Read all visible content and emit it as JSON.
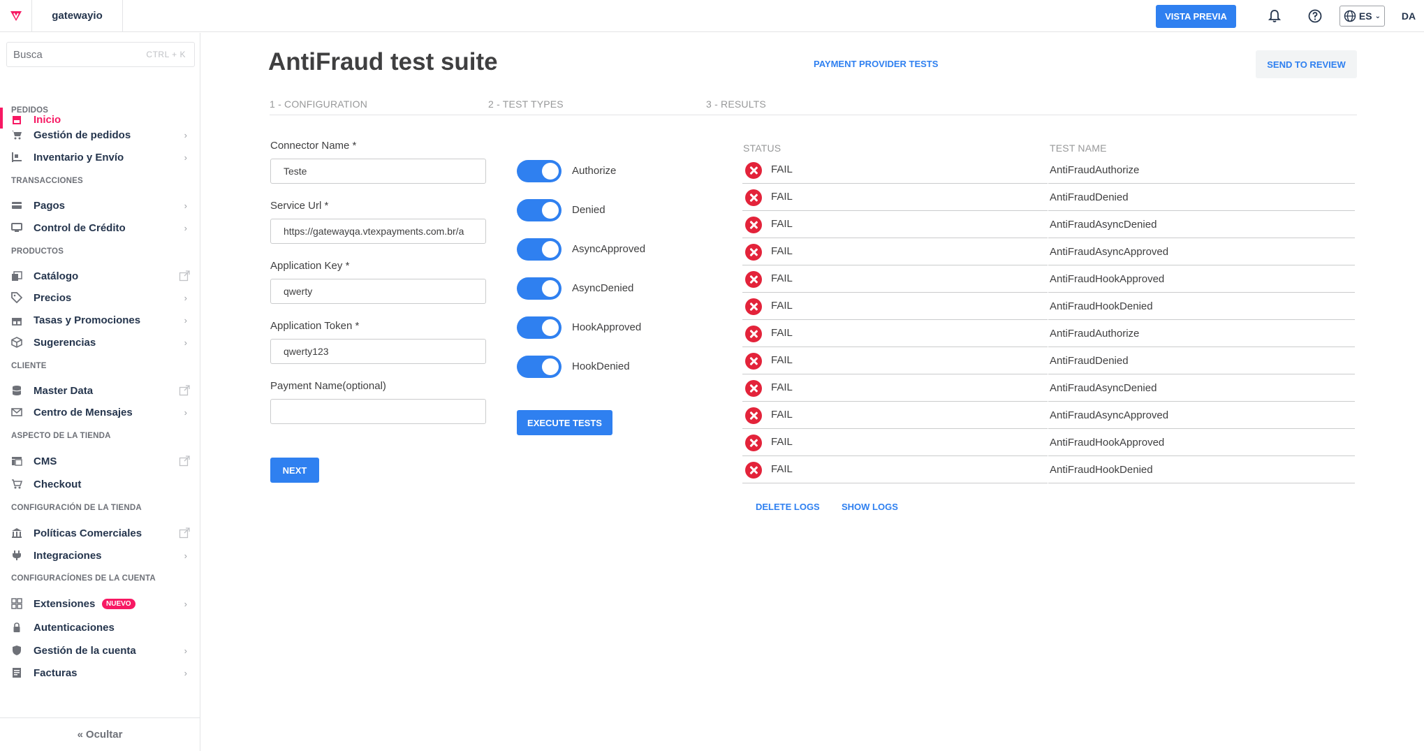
{
  "topbar": {
    "account": "gatewayio",
    "preview_label": "VISTA PREVIA",
    "lang": "ES",
    "user": "DA",
    "icons": [
      "vtex-logo-icon",
      "bell-icon",
      "help-icon",
      "globe-icon"
    ]
  },
  "sidebar": {
    "search_placeholder": "Busca",
    "search_shortcut": "CTRL + K",
    "home": "Inicio",
    "sections": {
      "pedidos": "PEDIDOS",
      "transacciones": "TRANSACCIONES",
      "productos": "PRODUCTOS",
      "cliente": "CLIENTE",
      "aspecto": "ASPECTO DE LA TIENDA",
      "config_tienda": "CONFIGURACIÓN DE LA TIENDA",
      "config_cuenta": "CONFIGURACÍONES DE LA CUENTA"
    },
    "items": {
      "gestion_pedidos": "Gestión de pedidos",
      "inventario": "Inventario y Envío",
      "pagos": "Pagos",
      "credito": "Control de Crédito",
      "catalogo": "Catálogo",
      "precios": "Precios",
      "tasas": "Tasas y Promociones",
      "sugerencias": "Sugerencias",
      "master_data": "Master Data",
      "mensajes": "Centro de Mensajes",
      "cms": "CMS",
      "checkout": "Checkout",
      "politicas": "Políticas Comerciales",
      "integraciones": "Integraciones",
      "extensiones": "Extensiones",
      "autenticaciones": "Autenticaciones",
      "gestion_cuenta": "Gestión de la cuenta",
      "facturas": "Facturas"
    },
    "new_badge": "NUEVO",
    "hide_label": "Ocultar"
  },
  "main": {
    "title": "AntiFraud test suite",
    "provider_link": "PAYMENT PROVIDER TESTS",
    "review_button": "SEND TO REVIEW",
    "steps": [
      "1 - CONFIGURATION",
      "2 - TEST TYPES",
      "3 - RESULTS"
    ],
    "form": {
      "connector_label": "Connector Name *",
      "connector_value": "Teste",
      "url_label": "Service Url *",
      "url_value": "https://gatewayqa.vtexpayments.com.br/a",
      "key_label": "Application Key *",
      "key_value": "qwerty",
      "token_label": "Application Token *",
      "token_value": "qwerty123",
      "payment_label": "Payment Name(optional)",
      "payment_value": "",
      "next_button": "NEXT"
    },
    "toggles": [
      {
        "label": "Authorize",
        "on": true
      },
      {
        "label": "Denied",
        "on": true
      },
      {
        "label": "AsyncApproved",
        "on": true
      },
      {
        "label": "AsyncDenied",
        "on": true
      },
      {
        "label": "HookApproved",
        "on": true
      },
      {
        "label": "HookDenied",
        "on": true
      }
    ],
    "execute_button": "EXECUTE TESTS",
    "results": {
      "col_status": "STATUS",
      "col_name": "TEST NAME",
      "rows": [
        {
          "status": "FAIL",
          "name": "AntiFraudAuthorize"
        },
        {
          "status": "FAIL",
          "name": "AntiFraudDenied"
        },
        {
          "status": "FAIL",
          "name": "AntiFraudAsyncDenied"
        },
        {
          "status": "FAIL",
          "name": "AntiFraudAsyncApproved"
        },
        {
          "status": "FAIL",
          "name": "AntiFraudHookApproved"
        },
        {
          "status": "FAIL",
          "name": "AntiFraudHookDenied"
        },
        {
          "status": "FAIL",
          "name": "AntiFraudAuthorize"
        },
        {
          "status": "FAIL",
          "name": "AntiFraudDenied"
        },
        {
          "status": "FAIL",
          "name": "AntiFraudAsyncDenied"
        },
        {
          "status": "FAIL",
          "name": "AntiFraudAsyncApproved"
        },
        {
          "status": "FAIL",
          "name": "AntiFraudHookApproved"
        },
        {
          "status": "FAIL",
          "name": "AntiFraudHookDenied"
        }
      ]
    },
    "delete_logs": "DELETE LOGS",
    "show_logs": "SHOW LOGS"
  },
  "colors": {
    "brand_pink": "#f71963",
    "action_blue": "#2f80f0",
    "fail_red": "#e3233a"
  }
}
